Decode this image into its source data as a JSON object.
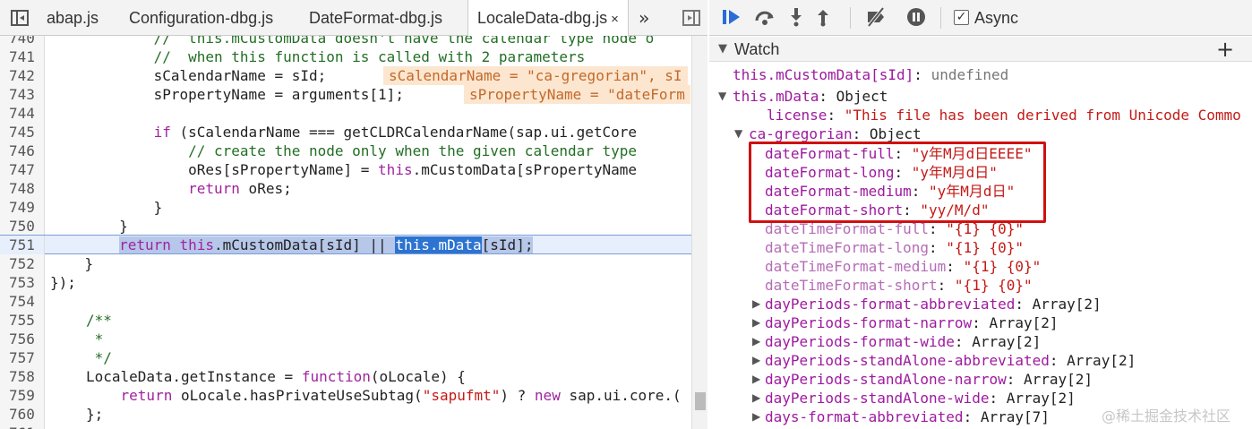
{
  "tabs": [
    {
      "label": "abap.js"
    },
    {
      "label": "Configuration-dbg.js"
    },
    {
      "label": "DateFormat-dbg.js"
    },
    {
      "label": "LocaleData-dbg.js",
      "close": "×"
    }
  ],
  "more_tabs": "»",
  "code_lines": [
    {
      "n": "740",
      "text": "            //  this.mCustomData doesn't have the calendar type node o"
    },
    {
      "n": "741",
      "text": "            //  when this function is called with 2 parameters"
    },
    {
      "n": "742",
      "text": "            sCalendarName = sId;",
      "inline": "sCalendarName = \"ca-gregorian\", sI"
    },
    {
      "n": "743",
      "text": "            sPropertyName = arguments[1];",
      "inline": "sPropertyName = \"dateForm"
    },
    {
      "n": "744",
      "text": ""
    },
    {
      "n": "745",
      "text": "            if (sCalendarName === getCLDRCalendarName(sap.ui.getCore"
    },
    {
      "n": "746",
      "text": "                // create the node only when the given calendar type"
    },
    {
      "n": "747",
      "text": "                oRes[sPropertyName] = this.mCustomData[sPropertyName"
    },
    {
      "n": "748",
      "text": "                return oRes;"
    },
    {
      "n": "749",
      "text": "            }"
    },
    {
      "n": "750",
      "text": "        }"
    },
    {
      "n": "751",
      "text": "        return this.mCustomData[sId] || this.mData[sId];"
    },
    {
      "n": "752",
      "text": "    }"
    },
    {
      "n": "753",
      "text": "});"
    },
    {
      "n": "754",
      "text": ""
    },
    {
      "n": "755",
      "text": "/**"
    },
    {
      "n": "756",
      "text": " *"
    },
    {
      "n": "757",
      "text": " */"
    },
    {
      "n": "758",
      "text": "LocaleData.getInstance = function(oLocale) {"
    },
    {
      "n": "759",
      "text": "    return oLocale.hasPrivateUseSubtag(\"sapufmt\") ? new sap.ui.core.("
    },
    {
      "n": "760",
      "text": "};"
    },
    {
      "n": "761",
      "text": ""
    }
  ],
  "debugger": {
    "async_label": "Async",
    "async_checked": "✓"
  },
  "watch": {
    "title": "Watch",
    "add": "+",
    "arrow": "▼",
    "entries": [
      {
        "key": "this.mCustomData[sId]",
        "value": "undefined"
      },
      {
        "key": "this.mData",
        "value": "Object"
      },
      {
        "key": "license",
        "value": "\"This file has been derived from Unicode Commo"
      },
      {
        "key": "ca-gregorian",
        "value": "Object"
      },
      {
        "key": "dateFormat-full",
        "value": "\"y年M月d日EEEE\""
      },
      {
        "key": "dateFormat-long",
        "value": "\"y年M月d日\""
      },
      {
        "key": "dateFormat-medium",
        "value": "\"y年M月d日\""
      },
      {
        "key": "dateFormat-short",
        "value": "\"yy/M/d\""
      },
      {
        "key": "dateTimeFormat-full",
        "value": "\"{1} {0}\""
      },
      {
        "key": "dateTimeFormat-long",
        "value": "\"{1} {0}\""
      },
      {
        "key": "dateTimeFormat-medium",
        "value": "\"{1} {0}\""
      },
      {
        "key": "dateTimeFormat-short",
        "value": "\"{1} {0}\""
      },
      {
        "key": "dayPeriods-format-abbreviated",
        "value": "Array[2]"
      },
      {
        "key": "dayPeriods-format-narrow",
        "value": "Array[2]"
      },
      {
        "key": "dayPeriods-format-wide",
        "value": "Array[2]"
      },
      {
        "key": "dayPeriods-standAlone-abbreviated",
        "value": "Array[2]"
      },
      {
        "key": "dayPeriods-standAlone-narrow",
        "value": "Array[2]"
      },
      {
        "key": "dayPeriods-standAlone-wide",
        "value": "Array[2]"
      },
      {
        "key": "days-format-abbreviated",
        "value": "Array[7]"
      }
    ]
  },
  "watermark": "@稀土掘金技术社区",
  "colors": {
    "highlight_box": "#d01010",
    "current_line": "#e6effb"
  }
}
